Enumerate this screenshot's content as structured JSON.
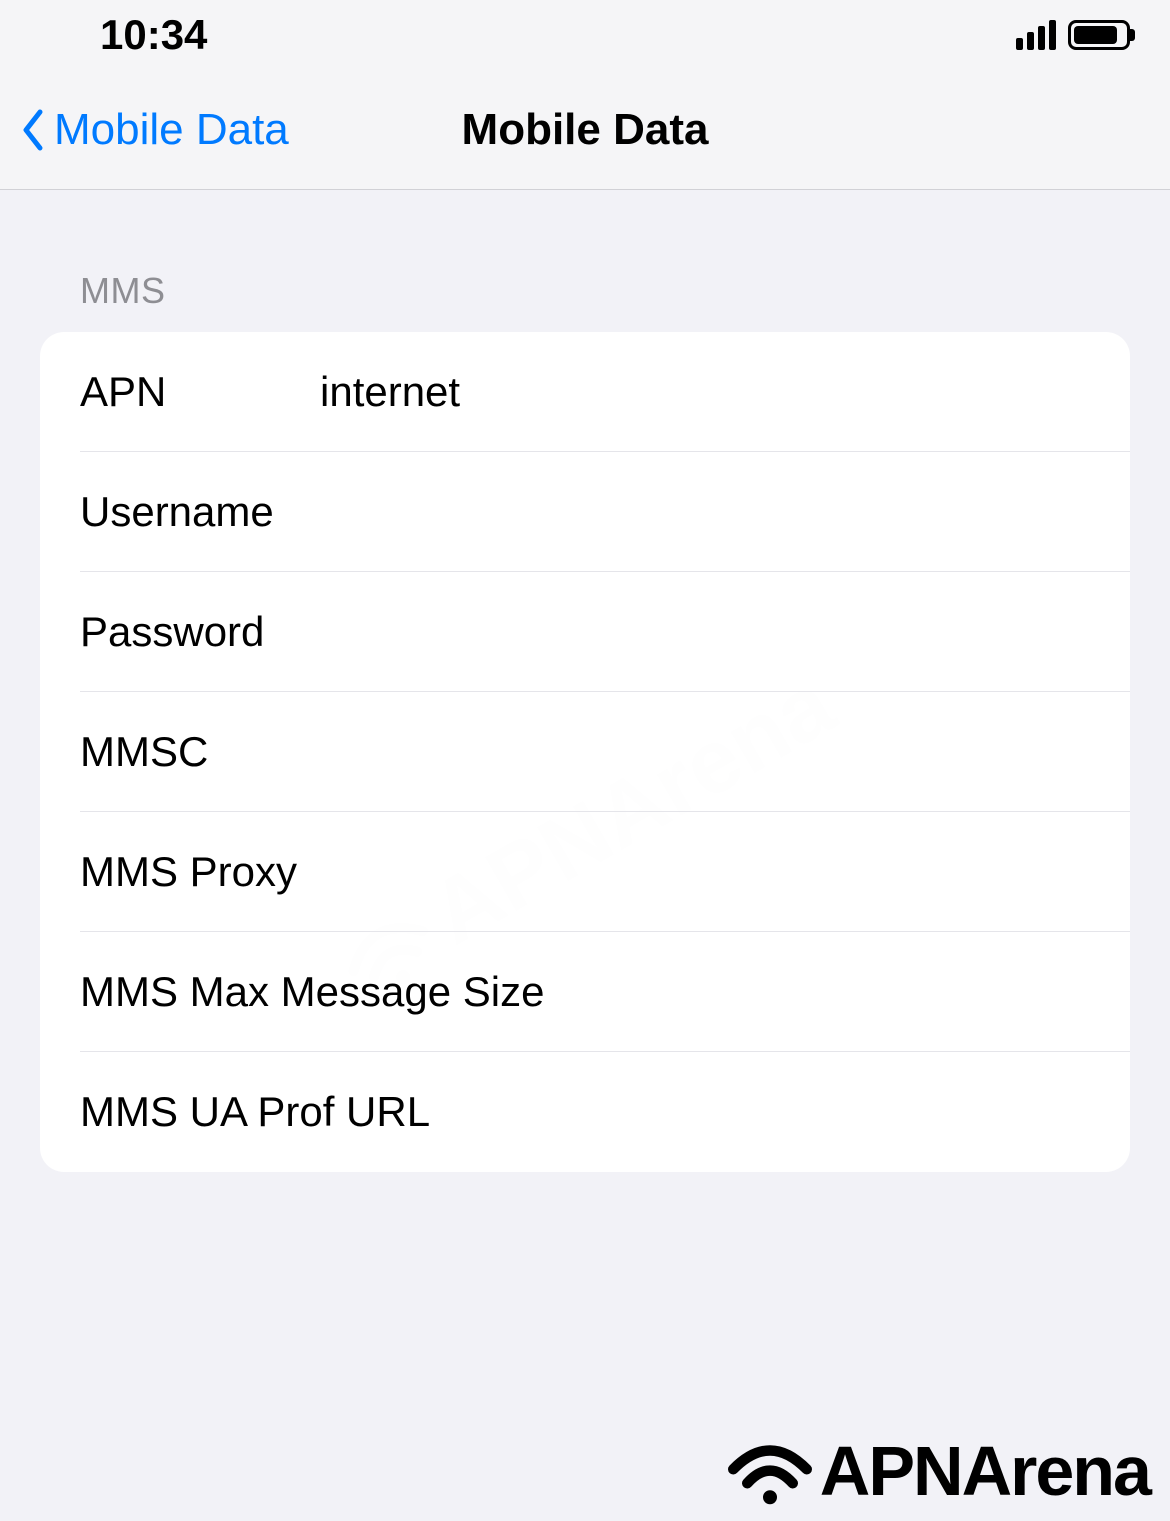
{
  "statusBar": {
    "time": "10:34"
  },
  "navBar": {
    "backLabel": "Mobile Data",
    "title": "Mobile Data"
  },
  "section": {
    "header": "MMS",
    "rows": {
      "apn": {
        "label": "APN",
        "value": "internet"
      },
      "username": {
        "label": "Username",
        "value": ""
      },
      "password": {
        "label": "Password",
        "value": ""
      },
      "mmsc": {
        "label": "MMSC",
        "value": ""
      },
      "mmsProxy": {
        "label": "MMS Proxy",
        "value": ""
      },
      "mmsMaxSize": {
        "label": "MMS Max Message Size",
        "value": ""
      },
      "mmsUaProf": {
        "label": "MMS UA Prof URL",
        "value": ""
      }
    }
  },
  "watermark": {
    "text": "APNArena"
  }
}
